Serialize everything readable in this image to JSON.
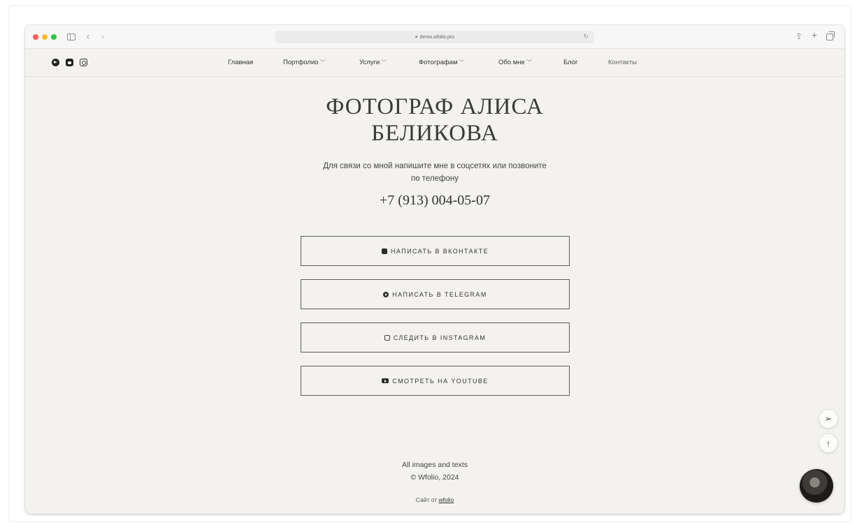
{
  "browser": {
    "url": "demo.wfolio.pro"
  },
  "nav": {
    "items": [
      {
        "label": "Главная",
        "dropdown": false
      },
      {
        "label": "Портфолио",
        "dropdown": true
      },
      {
        "label": "Услуги",
        "dropdown": true
      },
      {
        "label": "Фотографам",
        "dropdown": true
      },
      {
        "label": "Обо мне",
        "dropdown": true
      },
      {
        "label": "Блог",
        "dropdown": false
      },
      {
        "label": "Контакты",
        "dropdown": false
      }
    ]
  },
  "social_icons": [
    "telegram-icon",
    "vk-icon",
    "instagram-icon"
  ],
  "main": {
    "title_line1": "ФОТОГРАФ АЛИСА",
    "title_line2": "БЕЛИКОВА",
    "subtitle_line1": "Для связи со мной напишите мне в соцсетях или позвоните",
    "subtitle_line2": "по телефону",
    "phone": "+7 (913) 004-05-07",
    "buttons": [
      {
        "label": "НАПИСАТЬ В ВКОНТАКТЕ",
        "icon": "vk-icon"
      },
      {
        "label": "НАПИСАТЬ В TELEGRAM",
        "icon": "telegram-icon"
      },
      {
        "label": "СЛЕДИТЬ В INSTAGRAM",
        "icon": "instagram-icon"
      },
      {
        "label": "СМОТРЕТЬ НА YOUTUBE",
        "icon": "youtube-icon"
      }
    ]
  },
  "footer": {
    "line1": "All images and texts",
    "line2": "© Wfolio, 2024",
    "site_by": "Сайт от",
    "site_by_link": "wfolio"
  },
  "colors": {
    "page_bg": "#f3f2ef",
    "text": "#2b2b2b",
    "border": "#5a5a5a"
  }
}
